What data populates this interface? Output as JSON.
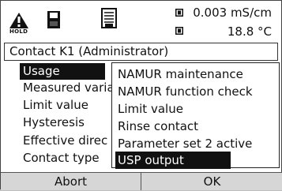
{
  "status": {
    "hold_label": "HOLD",
    "measurement_primary": "0.003 mS/cm",
    "measurement_secondary": "18.8 °C"
  },
  "title": "Contact K1 (Administrator)",
  "parameters": [
    "Usage",
    "Measured varia",
    "Limit value",
    "Hysteresis",
    "Effective direc",
    "Contact type"
  ],
  "usage_dropdown": {
    "options": [
      "NAMUR maintenance",
      "NAMUR function check",
      "Limit value",
      "Rinse contact",
      "Parameter set 2 active",
      "USP output"
    ],
    "selected_index": 5
  },
  "softkeys": {
    "left": "Abort",
    "right": "OK"
  }
}
